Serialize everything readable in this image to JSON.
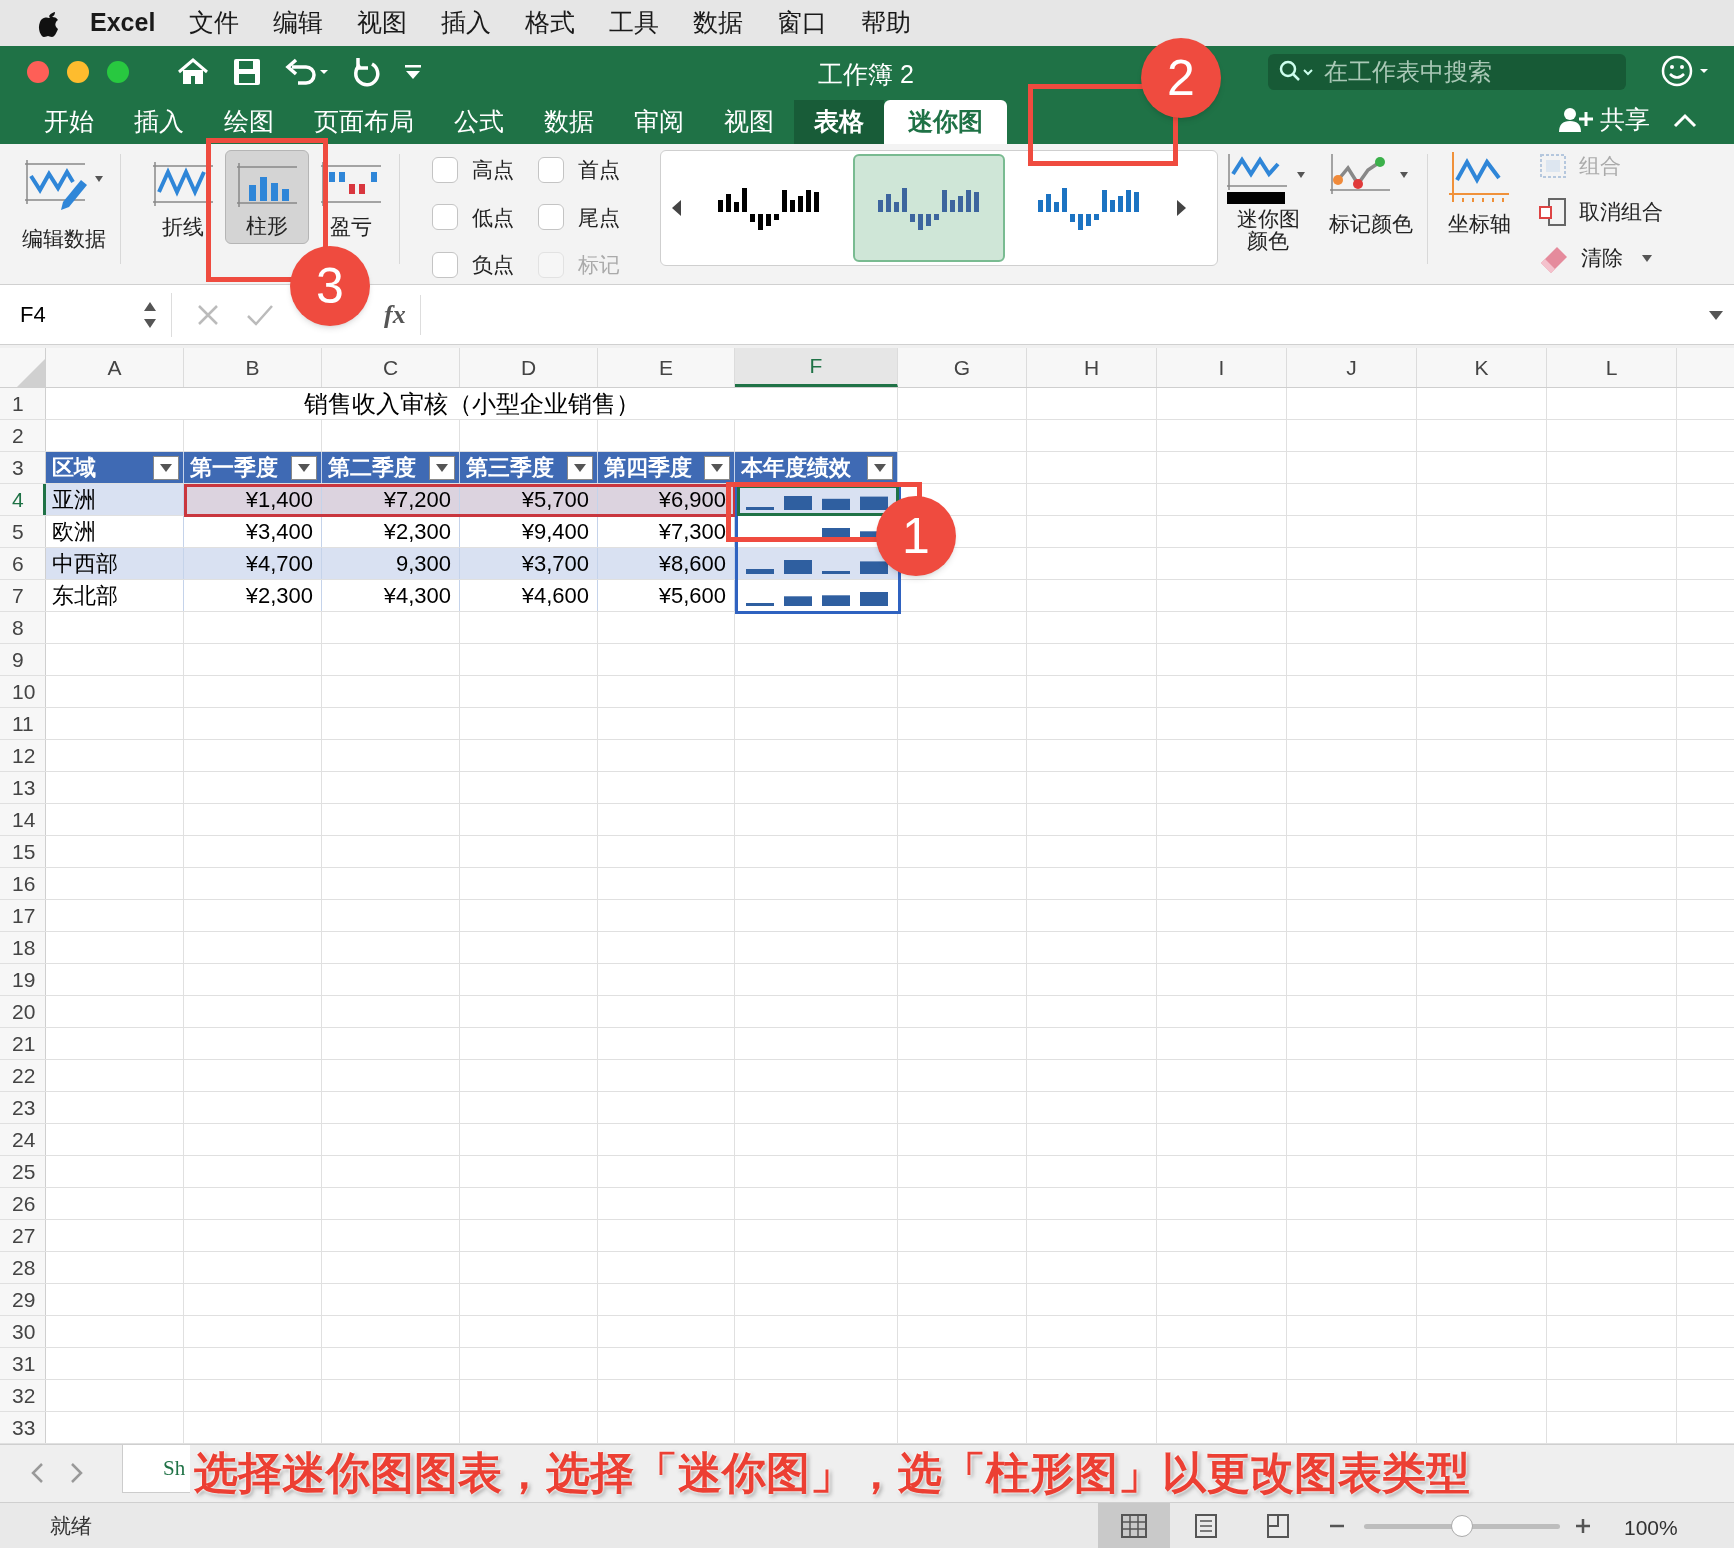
{
  "menu_bar": {
    "app": "Excel",
    "items": [
      "文件",
      "编辑",
      "视图",
      "插入",
      "格式",
      "工具",
      "数据",
      "窗口",
      "帮助"
    ]
  },
  "title_bar": {
    "title": "工作簿 2",
    "search": {
      "placeholder": "在工作表中搜索"
    }
  },
  "ribbon_tabs": [
    {
      "label": "开始",
      "selected": false,
      "contextual": false
    },
    {
      "label": "插入",
      "selected": false,
      "contextual": false
    },
    {
      "label": "绘图",
      "selected": false,
      "contextual": false
    },
    {
      "label": "页面布局",
      "selected": false,
      "contextual": false
    },
    {
      "label": "公式",
      "selected": false,
      "contextual": false
    },
    {
      "label": "数据",
      "selected": false,
      "contextual": false
    },
    {
      "label": "审阅",
      "selected": false,
      "contextual": false
    },
    {
      "label": "视图",
      "selected": false,
      "contextual": false
    },
    {
      "label": "表格",
      "selected": false,
      "contextual": true
    },
    {
      "label": "迷你图",
      "selected": true,
      "contextual": true
    }
  ],
  "share": "共享",
  "ribbon": {
    "edit_data": "编辑数据",
    "type_buttons": [
      {
        "kind": "line",
        "label": "折线",
        "selected": false
      },
      {
        "kind": "column",
        "label": "柱形",
        "selected": true
      },
      {
        "kind": "winloss",
        "label": "盈亏",
        "selected": false
      }
    ],
    "show_options": [
      {
        "label": "高点",
        "checked": false,
        "disabled": false
      },
      {
        "label": "首点",
        "checked": false,
        "disabled": false
      },
      {
        "label": "低点",
        "checked": false,
        "disabled": false
      },
      {
        "label": "尾点",
        "checked": false,
        "disabled": false
      },
      {
        "label": "负点",
        "checked": false,
        "disabled": false
      },
      {
        "label": "标记",
        "checked": false,
        "disabled": true
      }
    ],
    "styles": [
      {
        "color": "#000000",
        "selected": false
      },
      {
        "color": "#3d659e",
        "selected": true
      },
      {
        "color": "#1c73c2",
        "selected": false
      }
    ],
    "sparkline_color": "迷你图颜色",
    "marker_color": "标记颜色",
    "axis": "坐标轴",
    "group_buttons": [
      {
        "kind": "group",
        "label": "组合",
        "disabled": true
      },
      {
        "kind": "ungroup",
        "label": "取消组合",
        "disabled": false
      },
      {
        "kind": "clear",
        "label": "清除",
        "disabled": false
      }
    ]
  },
  "formula_bar": {
    "function_label": "fx"
  },
  "sheet": {
    "columns": [
      "A",
      "B",
      "C",
      "D",
      "E",
      "F",
      "G",
      "H",
      "I",
      "J",
      "K",
      "L"
    ],
    "row_labels": [
      "1",
      "2",
      "3",
      "4",
      "5",
      "6",
      "7",
      "8",
      "9",
      "10",
      "11",
      "12",
      "13",
      "14",
      "15",
      "16",
      "17",
      "18",
      "19",
      "20",
      "21",
      "22",
      "23",
      "24",
      "25",
      "26",
      "27",
      "28",
      "29",
      "30",
      "31",
      "32",
      "33"
    ],
    "title": "销售收入审核（小型企业销售）",
    "table_headers": [
      "区域",
      "第一季度",
      "第二季度",
      "第三季度",
      "第四季度",
      "本年度绩效"
    ],
    "table_rows": [
      {
        "region": "亚洲",
        "values": [
          "¥1,400",
          "¥7,200",
          "¥5,700",
          "¥6,900"
        ]
      },
      {
        "region": "欧洲",
        "values": [
          "¥3,400",
          "¥2,300",
          "¥9,400",
          "¥7,300"
        ]
      },
      {
        "region": "中西部",
        "values": [
          "¥4,700",
          "9,300",
          "¥3,700",
          "¥8,600"
        ]
      },
      {
        "region": "东北部",
        "values": [
          "¥2,300",
          "¥4,300",
          "¥4,600",
          "¥5,600"
        ]
      }
    ],
    "active_cell": "F4"
  },
  "sheet_tabs": [
    {
      "label": "Sh",
      "selected": true
    }
  ],
  "status_bar": {
    "status": "就绪",
    "views": [
      {
        "kind": "normal",
        "selected": true
      },
      {
        "kind": "layout",
        "selected": false
      },
      {
        "kind": "break",
        "selected": false
      }
    ],
    "zoom": {
      "level": 0.5,
      "reading": "100%"
    }
  },
  "callouts": [
    {
      "label": "1"
    },
    {
      "label": "2"
    },
    {
      "label": "3"
    }
  ],
  "caption": "选择迷你图图表，选择「迷你图」，选「柱形图」以更改图表类型"
}
